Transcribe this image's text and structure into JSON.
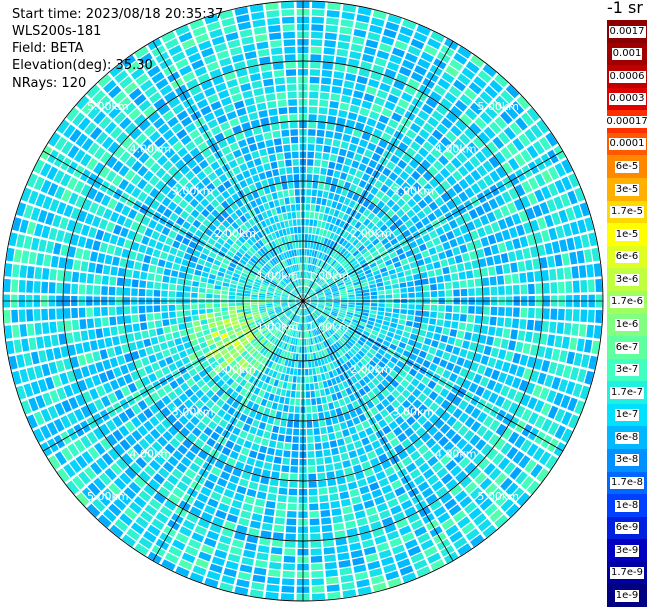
{
  "header": {
    "start_time": "Start time: 2023/08/18 20:35:37",
    "instrument": "WLS200s-181",
    "field": "Field: BETA",
    "elevation": "Elevation(deg): 35.30",
    "nrays": "NRays: 120"
  },
  "chart_data": {
    "type": "heatmap",
    "projection": "polar-ppi",
    "nrays": 120,
    "range_rings_km": [
      1,
      2,
      3,
      4,
      5
    ],
    "range_ring_labels": [
      "1.00km",
      "2.00km",
      "3.00km",
      "4.00km",
      "5.00km"
    ],
    "max_range_km": 5.0,
    "grid": true,
    "colormap": [
      "#000080",
      "#0000d0",
      "#0040ff",
      "#0090ff",
      "#00d0ff",
      "#40ffc0",
      "#a0ff60",
      "#ffff00",
      "#ffc000",
      "#ff6000",
      "#ff1000",
      "#b00000",
      "#800000"
    ],
    "legend": {
      "title": "-1 sr",
      "position": "right",
      "ticks": [
        {
          "label": "0.0017",
          "color": "#8b0000"
        },
        {
          "label": "0.001",
          "color": "#a00000"
        },
        {
          "label": "0.0006",
          "color": "#c00000"
        },
        {
          "label": "0.0003",
          "color": "#e00000"
        },
        {
          "label": "0.00017",
          "color": "#ff3000"
        },
        {
          "label": "0.0001",
          "color": "#ff5a00"
        },
        {
          "label": "6e-5",
          "color": "#ff8800"
        },
        {
          "label": "3e-5",
          "color": "#ffb000"
        },
        {
          "label": "1.7e-5",
          "color": "#ffd800"
        },
        {
          "label": "1e-5",
          "color": "#ffff00"
        },
        {
          "label": "6e-6",
          "color": "#e0ff20"
        },
        {
          "label": "3e-6",
          "color": "#c0ff40"
        },
        {
          "label": "1.7e-6",
          "color": "#a0ff60"
        },
        {
          "label": "1e-6",
          "color": "#80ff80"
        },
        {
          "label": "6e-7",
          "color": "#60ffa0"
        },
        {
          "label": "3e-7",
          "color": "#40ffc0"
        },
        {
          "label": "1.7e-7",
          "color": "#20f0e0"
        },
        {
          "label": "1e-7",
          "color": "#00e0ff"
        },
        {
          "label": "6e-8",
          "color": "#00b8ff"
        },
        {
          "label": "3e-8",
          "color": "#0090ff"
        },
        {
          "label": "1.7e-8",
          "color": "#0068ff"
        },
        {
          "label": "1e-8",
          "color": "#0040ff"
        },
        {
          "label": "6e-9",
          "color": "#0020e0"
        },
        {
          "label": "3e-9",
          "color": "#0000c0"
        },
        {
          "label": "1.7e-9",
          "color": "#0000a0"
        },
        {
          "label": "1e-9",
          "color": "#000080"
        }
      ]
    }
  }
}
